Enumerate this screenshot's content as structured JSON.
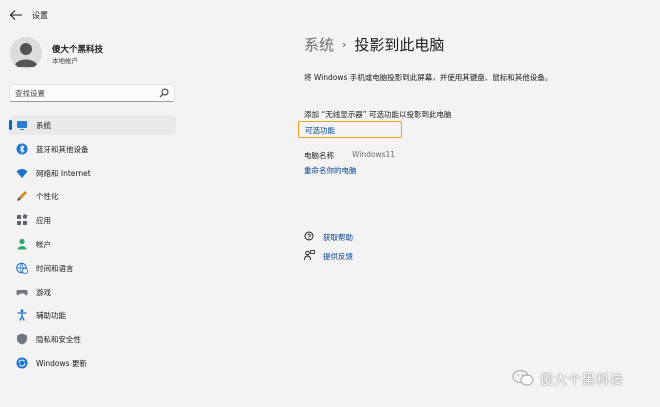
{
  "app": {
    "title": "设置"
  },
  "profile": {
    "name": "傻大个黑科技",
    "account_type": "本地帐户"
  },
  "search": {
    "placeholder": "查找设置"
  },
  "nav": {
    "items": [
      {
        "label": "系统",
        "icon": "monitor-icon",
        "active": true
      },
      {
        "label": "蓝牙和其他设备",
        "icon": "bluetooth-icon"
      },
      {
        "label": "网络和 Internet",
        "icon": "wifi-icon"
      },
      {
        "label": "个性化",
        "icon": "brush-icon"
      },
      {
        "label": "应用",
        "icon": "apps-icon"
      },
      {
        "label": "帐户",
        "icon": "person-icon"
      },
      {
        "label": "时间和语言",
        "icon": "globe-clock-icon"
      },
      {
        "label": "游戏",
        "icon": "gamepad-icon"
      },
      {
        "label": "辅助功能",
        "icon": "accessibility-icon"
      },
      {
        "label": "隐私和安全性",
        "icon": "shield-icon"
      },
      {
        "label": "Windows 更新",
        "icon": "update-icon"
      }
    ]
  },
  "main": {
    "breadcrumb": {
      "parent": "系统",
      "separator": "›",
      "current": "投影到此电脑"
    },
    "description": "将 Windows 手机或电脑投影到此屏幕，并使用其键盘、鼠标和其他设备。",
    "add_wireless_text": "添加 “无线显示器” 可选功能以投影到此电脑",
    "optional_features_link": "可选功能",
    "pc_name_label": "电脑名称",
    "pc_name_value": "Windows11",
    "rename_link": "重命名你的电脑",
    "get_help": "获取帮助",
    "give_feedback": "提供反馈"
  },
  "watermark": {
    "text": "傻大个黑科技"
  },
  "colors": {
    "accent": "#0067c0",
    "link": "#003e92",
    "highlight_border": "#e8a317",
    "background": "#f3f3f3"
  }
}
